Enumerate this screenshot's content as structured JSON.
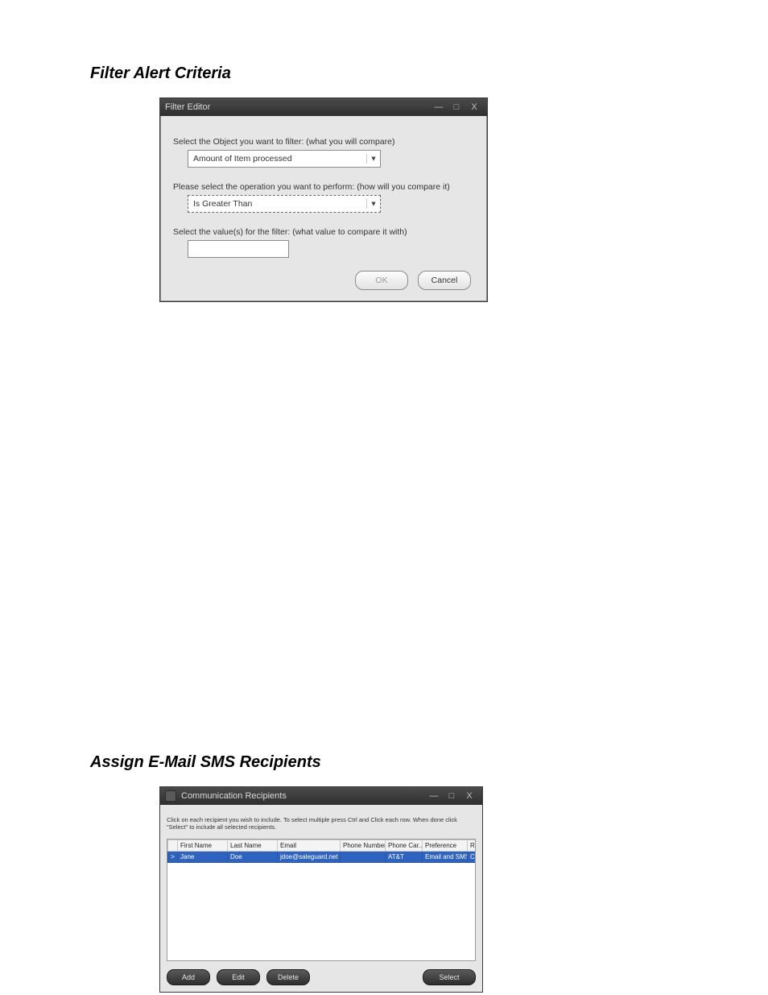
{
  "section1": {
    "heading": "Filter Alert Criteria"
  },
  "filterEditor": {
    "title": "Filter Editor",
    "label_object": "Select the Object you want to filter: (what you will compare)",
    "combo_object": "Amount of Item processed",
    "label_operation": "Please select the operation you want to perform: (how will you compare it)",
    "combo_operation": "Is Greater Than",
    "label_value": "Select the value(s) for the filter: (what value to compare it with)",
    "value_text": "",
    "ok": "OK",
    "cancel": "Cancel",
    "min_glyph": "—",
    "max_glyph": "□",
    "close_glyph": "X"
  },
  "section2": {
    "heading": "Assign E-Mail SMS Recipients"
  },
  "recipients": {
    "title": "Communication Recipients",
    "instructions": "Click on each recipient you wish to include. To select multiple press Ctrl and Click each row. When done click \"Select\" to include all selected recipients.",
    "columns": [
      "First Name",
      "Last Name",
      "Email",
      "Phone Number",
      "Phone Car...",
      "Preference",
      "Recipient Type"
    ],
    "row_pointer": ">",
    "rows": [
      {
        "first": "Jane",
        "last": "Doe",
        "email": "jdoe@saleguard.net",
        "phone": "",
        "carrier": "AT&T",
        "pref": "Email and SMS",
        "type": "Contact"
      }
    ],
    "buttons": {
      "add": "Add",
      "edit": "Edit",
      "delete": "Delete",
      "select": "Select"
    },
    "min_glyph": "—",
    "max_glyph": "□",
    "close_glyph": "X"
  }
}
